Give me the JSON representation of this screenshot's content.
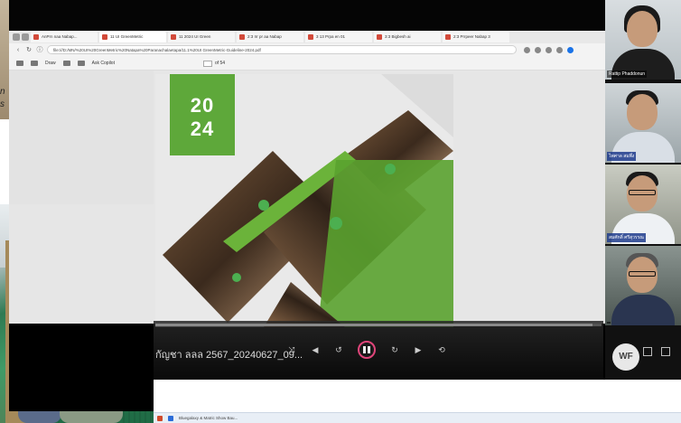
{
  "browser": {
    "tabs": [
      "AnPrn naa Nabap...",
      "11 UI GreenMetric",
      "11 2024 UI Green",
      "2:3 Irr pr aa Nabap",
      "3 13 Prpa en 01",
      "3:3 Bigbesh ai",
      "2:3 Prrpeer Nabap 3"
    ],
    "url": "file:///D:/MN/%20UI%20GreenMetric%20Natapa%20Paranachalaetapa/11.1%20UI GreenMetric-Guideline-2024.pdf",
    "pdf_toolbar": {
      "draw_label": "Draw",
      "ask_label": "Ask Copilot",
      "page_total": "of 54"
    }
  },
  "pdf_page": {
    "year_line1": "20",
    "year_line2": "24"
  },
  "video": {
    "title": "กัญชา ลลล 2567_20240627_09...",
    "progress_fraction": 0.98
  },
  "taskbar": {
    "item": "Bluegalaxy & Matric Show Bau..."
  },
  "participants": [
    {
      "name": "Rattip Phaddonun"
    },
    {
      "name": "ไพศาล สมพึ่ง"
    },
    {
      "name": "สมศักดิ์ ศรีสุวรรณ"
    },
    {
      "name": ""
    }
  ],
  "self_avatar": "WF",
  "left_photo_text": [
    "n",
    "s"
  ]
}
